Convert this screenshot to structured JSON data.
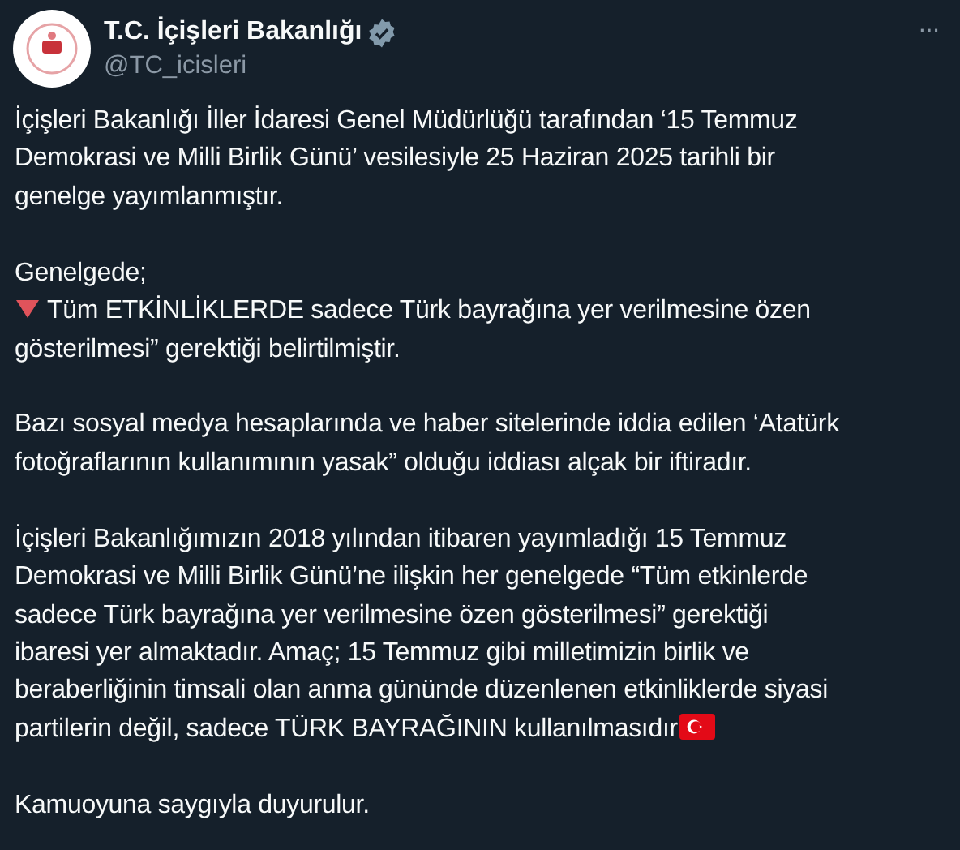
{
  "author": {
    "name": "T.C. İçişleri Bakanlığı",
    "verified": true,
    "handle": "@TC_icisleri"
  },
  "more_button": "···",
  "paragraphs": [
    {
      "lines": [
        "İçişleri Bakanlığı İller İdaresi Genel Müdürlüğü tarafından ‘15 Temmuz",
        "Demokrasi ve Milli Birlik Günü’ vesilesiyle 25 Haziran 2025 tarihli bir",
        "genelge yayımlanmıştır."
      ]
    },
    {
      "lines": [
        "Genelgede;",
        {
          "kind": "triangle",
          "text": "Tüm ETKİNLİKLERDE sadece Türk bayrağına yer verilmesine özen"
        },
        "gösterilmesi” gerektiği belirtilmiştir."
      ]
    },
    {
      "lines": [
        "Bazı sosyal medya hesaplarında ve haber sitelerinde iddia edilen ‘Atatürk",
        "fotoğraflarının kullanımının yasak” olduğu iddiası alçak bir iftiradır."
      ]
    },
    {
      "lines": [
        "İçişleri Bakanlığımızın 2018 yılından itibaren yayımladığı 15 Temmuz",
        "Demokrasi ve Milli Birlik Günü’ne ilişkin her genelgede “Tüm etkinlerde",
        "sadece Türk bayrağına yer verilmesine özen gösterilmesi” gerektiği",
        "ibaresi yer almaktadır. Amaç; 15 Temmuz gibi milletimizin birlik ve",
        "beraberliğinin timsali olan anma gününde düzenlenen etkinliklerde siyasi",
        {
          "text": "partilerin değil, sadece TÜRK BAYRAĞININ kullanılmasıdır",
          "kind": "flag"
        }
      ]
    },
    {
      "lines": [
        "Kamuoyuna saygıyla duyurulur."
      ]
    }
  ]
}
